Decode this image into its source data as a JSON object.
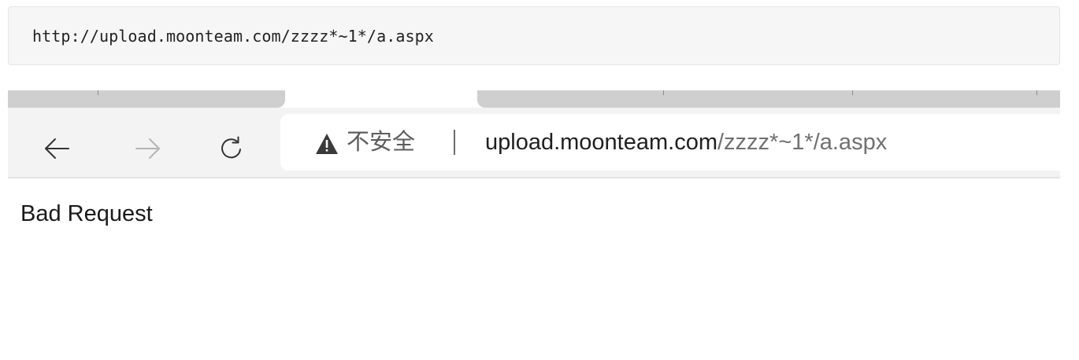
{
  "code_block": {
    "text": "http://upload.moonteam.com/zzzz*~1*/a.aspx"
  },
  "browser": {
    "toolbar": {
      "back_icon": "arrow-left-icon",
      "forward_icon": "arrow-right-icon",
      "reload_icon": "reload-icon"
    },
    "address_bar": {
      "security_icon": "warning-triangle-icon",
      "security_label": "不安全",
      "url_host": "upload.moonteam.com",
      "url_path": "/zzzz*~1*/a.aspx"
    },
    "page": {
      "body_text": "Bad Request"
    }
  }
}
